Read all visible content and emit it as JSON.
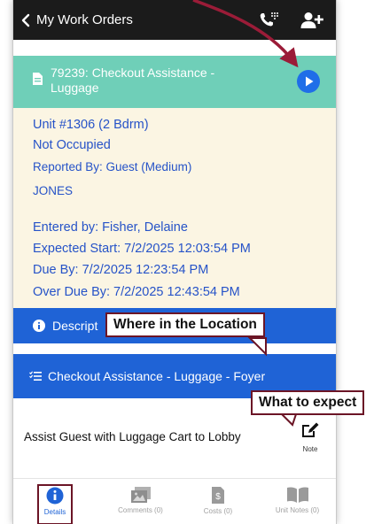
{
  "header": {
    "back_label": "My Work Orders",
    "icons": [
      "chevron-left-icon",
      "phone-dial-icon",
      "add-user-icon"
    ]
  },
  "work_order": {
    "title": "79239: Checkout Assistance - Luggage",
    "icon": "document-icon",
    "play_icon": "play-icon"
  },
  "details": {
    "unit": "Unit #1306 (2 Bdrm)",
    "occupancy": "Not Occupied",
    "reported_by": "Reported By: Guest  (Medium)",
    "name": "JONES",
    "entered_by": "Entered by: Fisher, Delaine",
    "expected_start": "Expected Start: 7/2/2025 12:03:54 PM",
    "due_by": "Due By: 7/2/2025 12:23:54 PM",
    "over_due_by": "Over Due By: 7/2/2025 12:43:54 PM"
  },
  "description_bar": {
    "label": "Descript"
  },
  "location_bar": {
    "label": "Checkout Assistance - Luggage - Foyer"
  },
  "note": {
    "text": "Assist Guest with Luggage Cart to Lobby",
    "button_caption": "Note"
  },
  "annotations": {
    "where": "Where in the Location",
    "expect": "What to expect"
  },
  "tabs": [
    {
      "label": "Details",
      "icon": "info-icon",
      "active": true
    },
    {
      "label": "Comments (0)",
      "icon": "image-icon",
      "active": false
    },
    {
      "label": "Costs (0)",
      "icon": "invoice-icon",
      "active": false
    },
    {
      "label": "Unit Notes (0)",
      "icon": "book-icon",
      "active": false
    }
  ],
  "colors": {
    "topbar": "#1b1b1b",
    "header_teal": "#6fcfb8",
    "details_bg": "#fbf5e3",
    "details_text": "#2653c8",
    "section_blue": "#1f63d6",
    "play_blue": "#1f6ee8",
    "annotation": "#9b1c38"
  }
}
